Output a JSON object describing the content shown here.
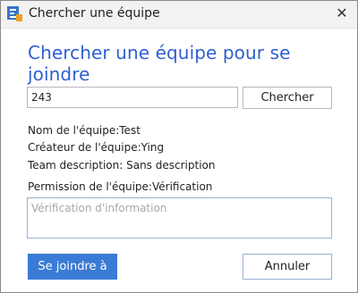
{
  "window": {
    "title": "Chercher une équipe",
    "close_glyph": "✕",
    "icon_name": "app-logo-icon",
    "accent_color": "#2f5fd0"
  },
  "heading": "Chercher une équipe pour se joindre",
  "search": {
    "value": "243",
    "button_label": "Chercher"
  },
  "team_info": {
    "name_label": "Nom de l'équipe:",
    "name_value": "Test",
    "creator_label": "Créateur de l'équipe:",
    "creator_value": "Ying",
    "description_label": "Team description: ",
    "description_value": "Sans description",
    "permission_label": "Permission de l'équipe:",
    "permission_value": "Vérification"
  },
  "verification": {
    "placeholder": "Vérification d'information",
    "value": ""
  },
  "actions": {
    "join_label": "Se joindre à",
    "cancel_label": "Annuler",
    "join_color": "#3a7bd5"
  }
}
